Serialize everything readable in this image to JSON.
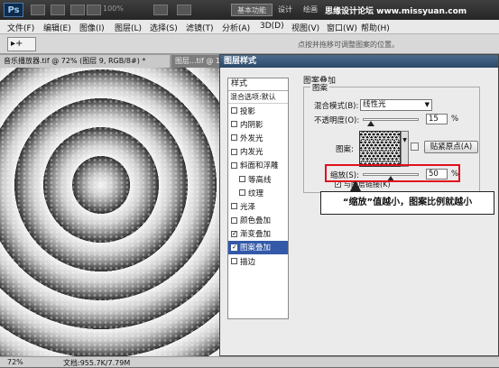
{
  "app": {
    "logo": "Ps",
    "zoom_menu": "100%"
  },
  "workspace": {
    "buttons": [
      "基本功能",
      "设计",
      "绘画"
    ],
    "active": "基本功能"
  },
  "watermark": "思缘设计论坛 www.missyuan.com",
  "menu": [
    "文件(F)",
    "编辑(E)",
    "图像(I)",
    "图层(L)",
    "选择(S)",
    "滤镜(T)",
    "分析(A)",
    "3D(D)",
    "视图(V)",
    "窗口(W)",
    "帮助(H)"
  ],
  "options": {
    "tool": "▸+",
    "hint": "点按并拖移可调整图案的位置。"
  },
  "doc_tabs": [
    {
      "label": "音乐播放器.tif @ 72% (图层 9, RGB/8#) *",
      "active": true
    },
    {
      "label": "图层...tif @ 1...",
      "active": false
    }
  ],
  "status": {
    "zoom": "72%",
    "doc": "文档:955.7K/7.79M"
  },
  "dialog": {
    "title": "图层样式",
    "styles_header": "样式",
    "blend_options": "混合选项:默认",
    "items": [
      {
        "label": "投影",
        "checked": false,
        "indent": false,
        "selected": false
      },
      {
        "label": "内阴影",
        "checked": false,
        "indent": false,
        "selected": false
      },
      {
        "label": "外发光",
        "checked": false,
        "indent": false,
        "selected": false
      },
      {
        "label": "内发光",
        "checked": false,
        "indent": false,
        "selected": false
      },
      {
        "label": "斜面和浮雕",
        "checked": false,
        "indent": false,
        "selected": false
      },
      {
        "label": "等高线",
        "checked": false,
        "indent": true,
        "selected": false
      },
      {
        "label": "纹理",
        "checked": false,
        "indent": true,
        "selected": false
      },
      {
        "label": "光泽",
        "checked": false,
        "indent": false,
        "selected": false
      },
      {
        "label": "颜色叠加",
        "checked": false,
        "indent": false,
        "selected": false
      },
      {
        "label": "渐变叠加",
        "checked": true,
        "indent": false,
        "selected": false
      },
      {
        "label": "图案叠加",
        "checked": true,
        "indent": false,
        "selected": true
      },
      {
        "label": "描边",
        "checked": false,
        "indent": false,
        "selected": false
      }
    ],
    "pattern_overlay": {
      "group_title": "图案叠加",
      "legend": "图案",
      "blend_mode_label": "混合模式(B):",
      "blend_mode": "线性光",
      "opacity_label": "不透明度(O):",
      "opacity": "15",
      "opacity_unit": "%",
      "opacity_fraction": 0.15,
      "pattern_label": "图案:",
      "snap_button": "贴紧原点(A)",
      "scale_label": "缩放(S):",
      "scale": "50",
      "scale_unit": "%",
      "scale_fraction": 0.5,
      "link_label": "与图层链接(K)"
    }
  },
  "callout": "“缩放”值越小，图案比例就越小",
  "colors": {
    "highlight": "#e0101e",
    "selection": "#3359a8",
    "title_bar": "#2c4868"
  }
}
